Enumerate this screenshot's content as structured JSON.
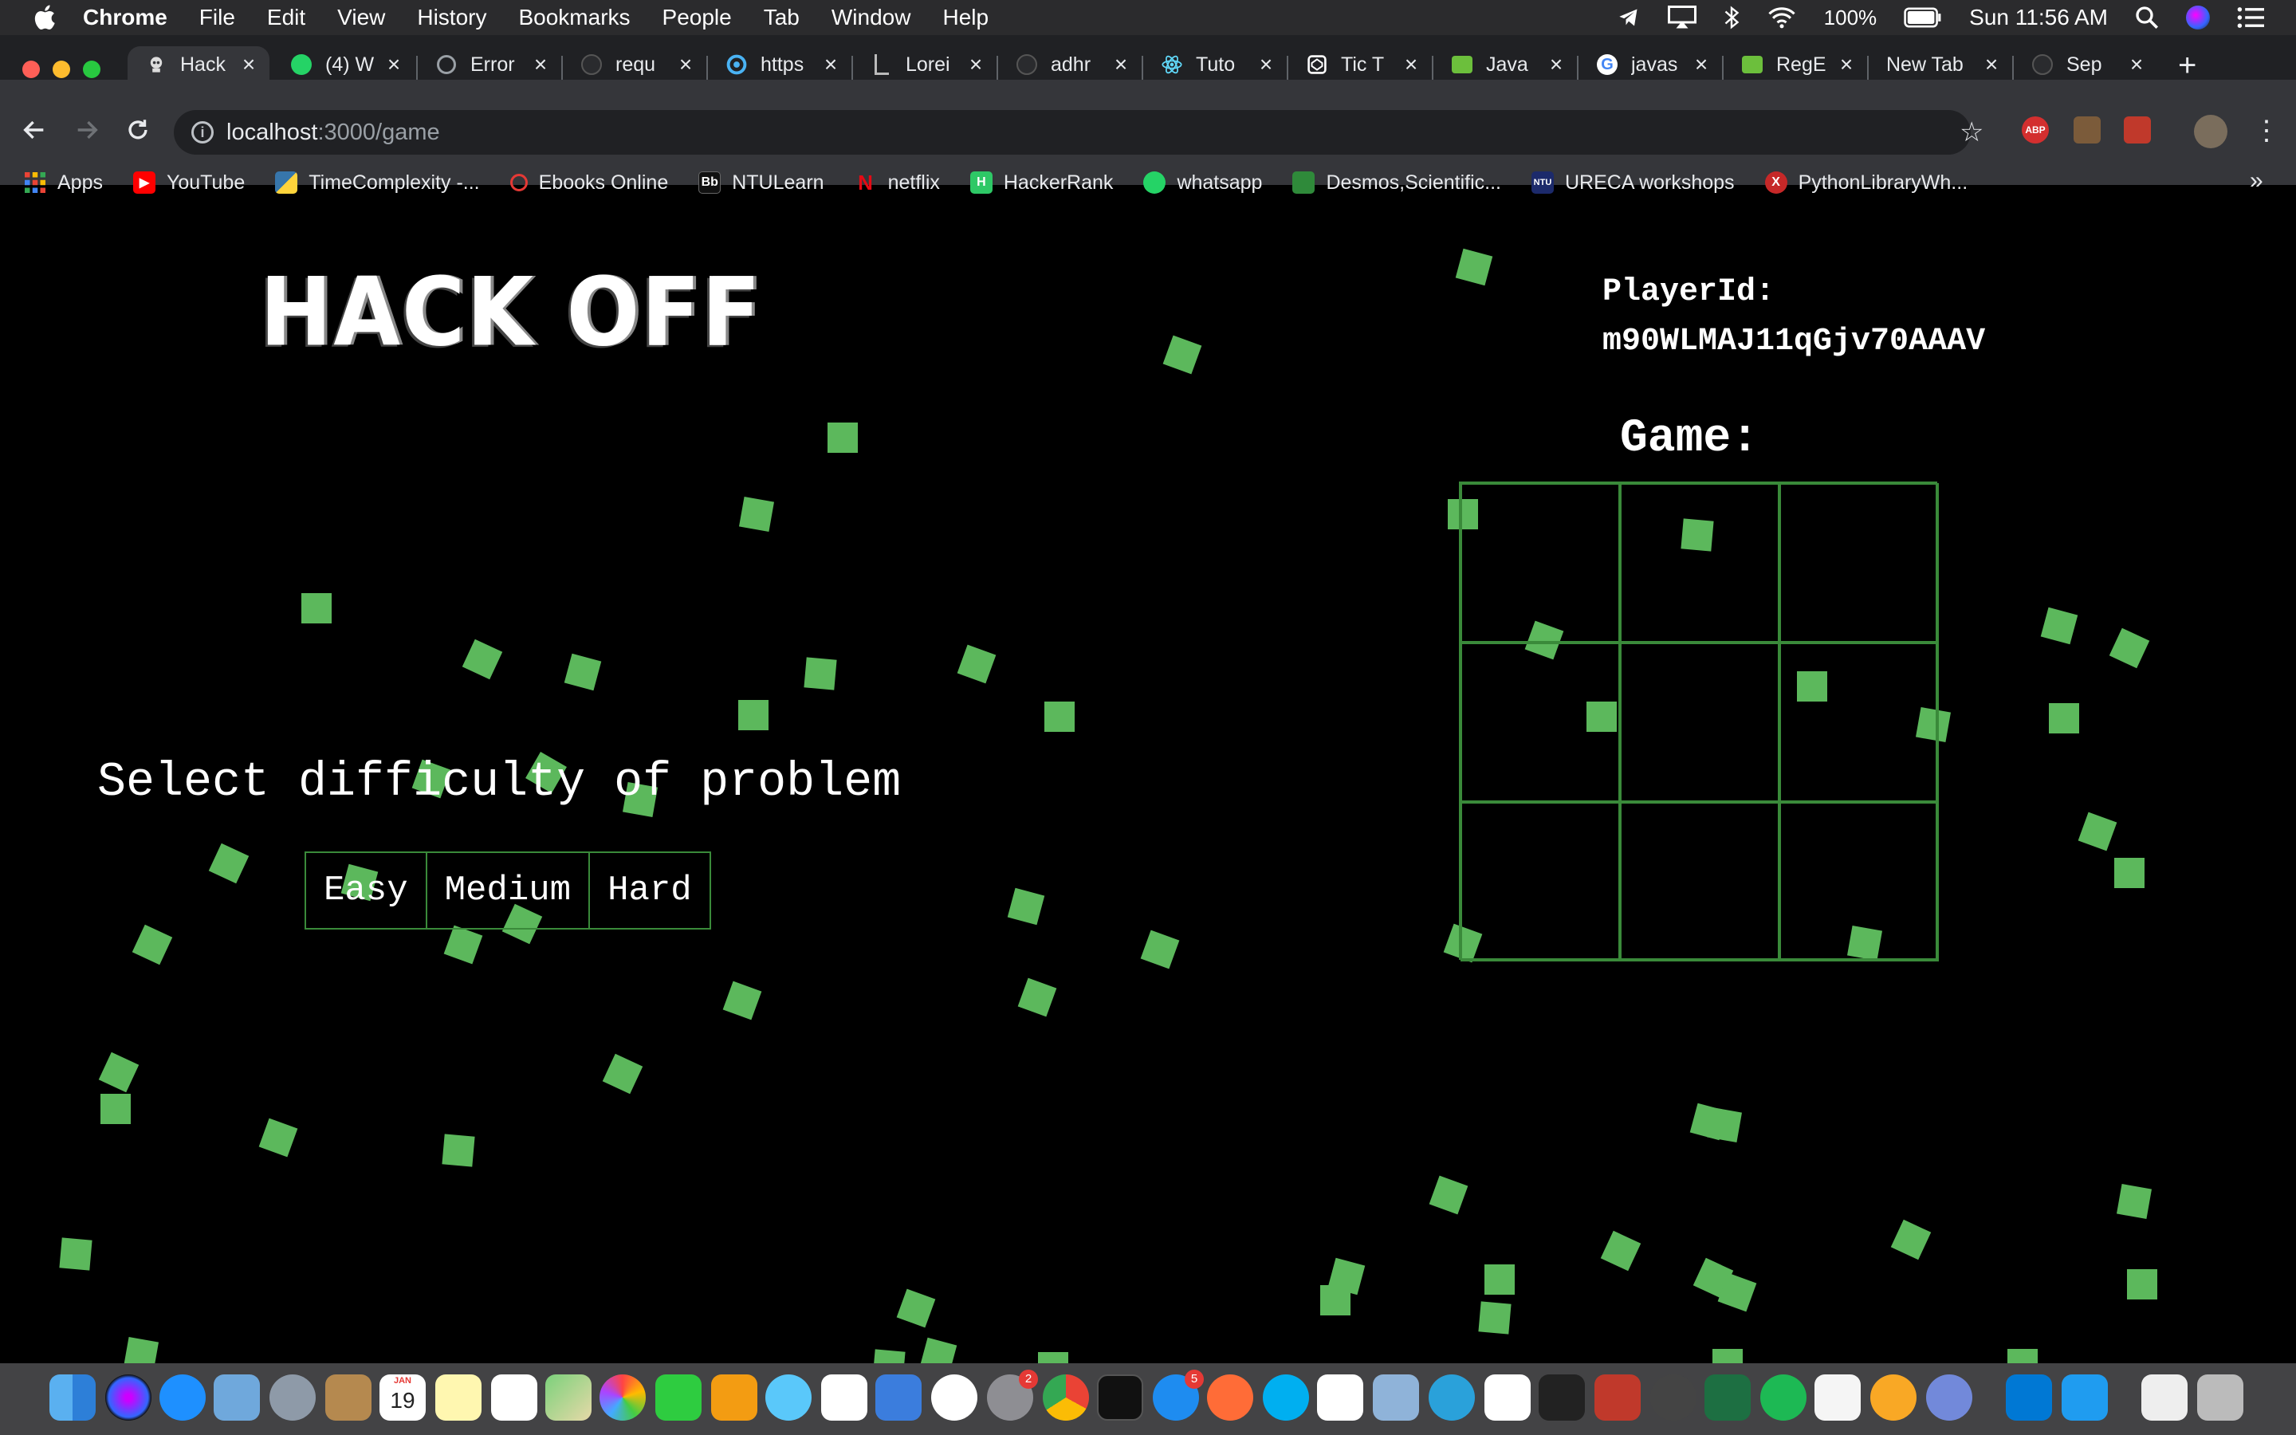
{
  "menubar": {
    "app_name": "Chrome",
    "items": [
      "File",
      "Edit",
      "View",
      "History",
      "Bookmarks",
      "People",
      "Tab",
      "Window",
      "Help"
    ],
    "battery": "100%",
    "clock": "Sun 11:56 AM"
  },
  "tabs": [
    {
      "title": "Hack",
      "icon": "hacker-favicon",
      "active": true
    },
    {
      "title": "(4) W",
      "icon": "whatsapp-icon"
    },
    {
      "title": "Error",
      "icon": "globe-icon"
    },
    {
      "title": "requ",
      "icon": "github-icon"
    },
    {
      "title": "https",
      "icon": "sourcegraph-icon"
    },
    {
      "title": "Lorei",
      "icon": "document-icon"
    },
    {
      "title": "adhr",
      "icon": "github-icon"
    },
    {
      "title": "Tuto",
      "icon": "react-icon"
    },
    {
      "title": "Tic T",
      "icon": "codepen-icon"
    },
    {
      "title": "Java",
      "icon": "regex-icon"
    },
    {
      "title": "javas",
      "icon": "google-icon"
    },
    {
      "title": "RegE",
      "icon": "regex-icon"
    },
    {
      "title": "New Tab",
      "icon": ""
    },
    {
      "title": "Sep",
      "icon": "github-icon"
    }
  ],
  "address_bar": {
    "host": "localhost",
    "path": ":3000/game"
  },
  "bookmarks": [
    {
      "label": "Apps",
      "icon": "apps-grid-icon",
      "color": "#4285f4"
    },
    {
      "label": "YouTube",
      "icon": "youtube-icon",
      "color": "#ff0000"
    },
    {
      "label": "TimeComplexity -...",
      "icon": "python-icon",
      "color": "#3776ab"
    },
    {
      "label": "Ebooks Online",
      "icon": "ebooks-icon",
      "color": "#e53935"
    },
    {
      "label": "NTULearn",
      "icon": "blackboard-icon",
      "color": "#111111"
    },
    {
      "label": "netflix",
      "icon": "netflix-icon",
      "color": "#e50914"
    },
    {
      "label": "HackerRank",
      "icon": "hackerrank-icon",
      "color": "#2ec866"
    },
    {
      "label": "whatsapp",
      "icon": "whatsapp-icon",
      "color": "#25d366"
    },
    {
      "label": "Desmos,Scientific...",
      "icon": "desmos-icon",
      "color": "#2f8a3a"
    },
    {
      "label": "URECA workshops",
      "icon": "ntu-icon",
      "color": "#1c2a6b"
    },
    {
      "label": "PythonLibraryWh...",
      "icon": "x-icon",
      "color": "#c62828"
    }
  ],
  "page": {
    "logo": "HACK OFF",
    "player_label": "PlayerId:",
    "player_id": "m90WLMAJ11qGjv70AAAV",
    "game_label": "Game:",
    "select_label": "Select difficulty of problem",
    "difficulty_buttons": [
      "Easy",
      "Medium",
      "Hard"
    ],
    "confetti_color": "#5cb85c",
    "board_color": "#3a8a3a"
  },
  "dock": {
    "calendar_month": "JAN",
    "calendar_day": "19",
    "badges": {
      "system_prefs": "2",
      "app_store": "5"
    }
  }
}
